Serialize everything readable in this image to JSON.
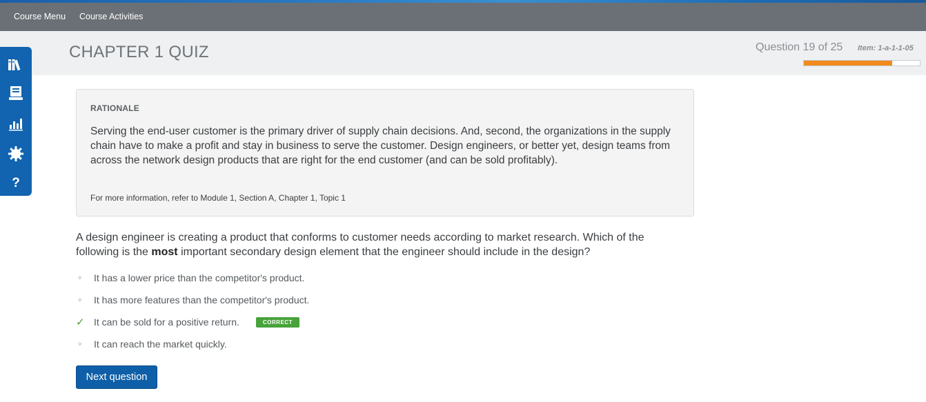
{
  "navbar": {
    "course_menu": "Course Menu",
    "course_activities": "Course Activities"
  },
  "header": {
    "title": "CHAPTER 1 QUIZ",
    "question_counter": "Question 19 of 25",
    "item_id": "Item: 1-a-1-1-05",
    "progress_fraction": 0.76
  },
  "toolbar": {
    "icons": [
      "library-icon",
      "notebook-icon",
      "bar-chart-icon",
      "settings-gear-icon",
      "help-icon"
    ]
  },
  "rationale": {
    "heading": "RATIONALE",
    "text": "Serving the end-user customer is the primary driver of supply chain decisions. And, second, the organizations in the supply chain have to make a profit and stay in business to serve the customer. Design engineers, or better yet, design teams from across the network design products that are right for the end customer (and can be sold profitably).",
    "reference": "For more information, refer to Module 1, Section A, Chapter 1, Topic 1"
  },
  "question": {
    "text_before": "A design engineer is creating a product that conforms to customer needs according to market research. Which of the following is the ",
    "emphasis": "most",
    "text_after": " important secondary design element that the engineer should include in the design?"
  },
  "answers": [
    {
      "text": "It has a lower price than the competitor's product.",
      "correct": false
    },
    {
      "text": "It has more features than the competitor's product.",
      "correct": false
    },
    {
      "text": "It can be sold for a positive return.",
      "correct": true
    },
    {
      "text": "It can reach the market quickly.",
      "correct": false
    }
  ],
  "correct_badge": "CORRECT",
  "bullet_glyph": "✧",
  "check_glyph": "✓",
  "next_button": "Next question",
  "colors": {
    "navbar": "#6b7076",
    "accent_blue": "#1264b0",
    "progress_orange": "#f08a1d",
    "correct_green": "#47a33a"
  }
}
